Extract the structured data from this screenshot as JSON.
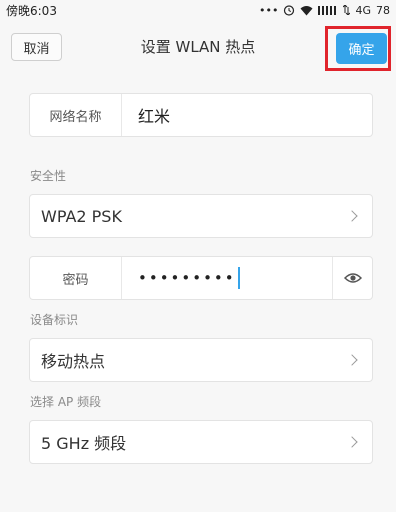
{
  "status": {
    "time": "傍晚6:03",
    "dots": "•••",
    "network": "4G",
    "battery": "78"
  },
  "nav": {
    "cancel_label": "取消",
    "title": "设置 WLAN 热点",
    "confirm_label": "确定"
  },
  "form": {
    "network_name_label": "网络名称",
    "network_name_value": "红米",
    "security_section": "安全性",
    "security_value": "WPA2 PSK",
    "password_label": "密码",
    "password_value": "•••••••••",
    "device_section": "设备标识",
    "device_value": "移动热点",
    "band_section": "选择 AP 频段",
    "band_value": "5 GHz 频段"
  },
  "colors": {
    "accent": "#35a4ea",
    "highlight": "#e0242c"
  }
}
